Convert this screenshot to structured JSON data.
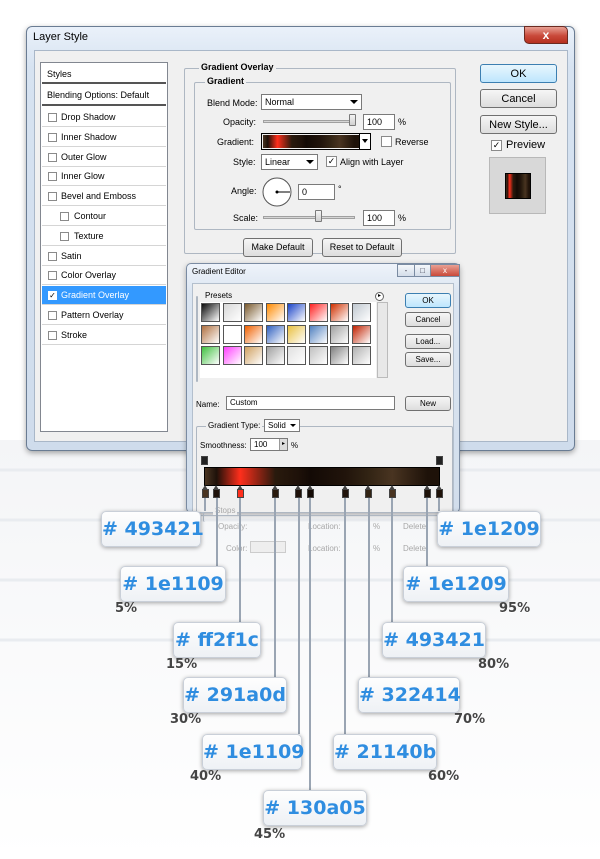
{
  "layer_style": {
    "title": "Layer Style",
    "close_glyph": "x",
    "styles_header": "Styles",
    "blending_options": "Blending Options: Default",
    "items": [
      {
        "label": "Drop Shadow",
        "checked": false,
        "indent": false
      },
      {
        "label": "Inner Shadow",
        "checked": false,
        "indent": false
      },
      {
        "label": "Outer Glow",
        "checked": false,
        "indent": false
      },
      {
        "label": "Inner Glow",
        "checked": false,
        "indent": false
      },
      {
        "label": "Bevel and Emboss",
        "checked": false,
        "indent": false
      },
      {
        "label": "Contour",
        "checked": false,
        "indent": true
      },
      {
        "label": "Texture",
        "checked": false,
        "indent": true
      },
      {
        "label": "Satin",
        "checked": false,
        "indent": false
      },
      {
        "label": "Color Overlay",
        "checked": false,
        "indent": false
      },
      {
        "label": "Gradient Overlay",
        "checked": true,
        "indent": false,
        "selected": true
      },
      {
        "label": "Pattern Overlay",
        "checked": false,
        "indent": false
      },
      {
        "label": "Stroke",
        "checked": false,
        "indent": false
      }
    ],
    "panel": {
      "title": "Gradient Overlay",
      "subtitle": "Gradient",
      "blend_mode_label": "Blend Mode:",
      "blend_mode_value": "Normal",
      "opacity_label": "Opacity:",
      "opacity_value": "100",
      "opacity_unit": "%",
      "opacity_level": 1.0,
      "gradient_label": "Gradient:",
      "reverse_label": "Reverse",
      "reverse_checked": false,
      "style_label": "Style:",
      "style_value": "Linear",
      "align_label": "Align with Layer",
      "align_checked": true,
      "angle_label": "Angle:",
      "angle_value": "0",
      "angle_unit": "°",
      "scale_label": "Scale:",
      "scale_value": "100",
      "scale_unit": "%",
      "scale_level": 0.4,
      "make_default": "Make Default",
      "reset_default": "Reset to Default"
    },
    "buttons": {
      "ok": "OK",
      "cancel": "Cancel",
      "new_style": "New Style...",
      "preview": "Preview"
    },
    "preview_checked": true
  },
  "gradient_editor": {
    "title": "Gradient Editor",
    "window_buttons": [
      "-",
      "□",
      "x"
    ],
    "presets_label": "Presets",
    "presets_menu_glyph": "▸",
    "buttons": {
      "ok": "OK",
      "cancel": "Cancel",
      "load": "Load...",
      "save": "Save...",
      "new": "New"
    },
    "name_label": "Name:",
    "name_value": "Custom",
    "gradient_type_label": "Gradient Type:",
    "gradient_type_value": "Solid",
    "smoothness_label": "Smoothness:",
    "smoothness_value": "100",
    "smoothness_unit": "%",
    "stops_label": "Stops",
    "opacity_label": "Opacity:",
    "color_label": "Color:",
    "location_label": "Location:",
    "location_unit": "%",
    "delete_label": "Delete",
    "presets": [
      "#0b0b0b",
      "#d8d8d8",
      "#7a5a2e",
      "#ff8a00",
      "#1b44c8",
      "#ff2020",
      "#d03000",
      "#c0c8d0",
      "#b07040",
      "#ffffff",
      "#f06000",
      "#3060c0",
      "#e8c040",
      "#5080c0",
      "#a0a0a0",
      "#c02000",
      "#40c040",
      "#ff40ff",
      "#d0a060",
      "#a0a0a0",
      "#e0e0e0",
      "#c0c0c0",
      "#808080",
      "#b0b0b0"
    ]
  },
  "stops": [
    {
      "hex": "# 493421",
      "color": "#493421",
      "location": 0,
      "pct": ""
    },
    {
      "hex": "# 1e1109",
      "color": "#1e1109",
      "location": 5,
      "pct": "5%"
    },
    {
      "hex": "# ff2f1c",
      "color": "#ff2f1c",
      "location": 15,
      "pct": "15%"
    },
    {
      "hex": "# 291a0d",
      "color": "#291a0d",
      "location": 30,
      "pct": "30%"
    },
    {
      "hex": "# 1e1109",
      "color": "#1e1109",
      "location": 40,
      "pct": "40%"
    },
    {
      "hex": "# 130a05",
      "color": "#130a05",
      "location": 45,
      "pct": "45%"
    },
    {
      "hex": "# 21140b",
      "color": "#21140b",
      "location": 60,
      "pct": "60%"
    },
    {
      "hex": "# 322414",
      "color": "#322414",
      "location": 70,
      "pct": "70%"
    },
    {
      "hex": "# 493421",
      "color": "#493421",
      "location": 80,
      "pct": "80%"
    },
    {
      "hex": "# 1e1209",
      "color": "#1e1209",
      "location": 95,
      "pct": "95%"
    },
    {
      "hex": "# 1e1209",
      "color": "#1e1209",
      "location": 100,
      "pct": ""
    }
  ]
}
